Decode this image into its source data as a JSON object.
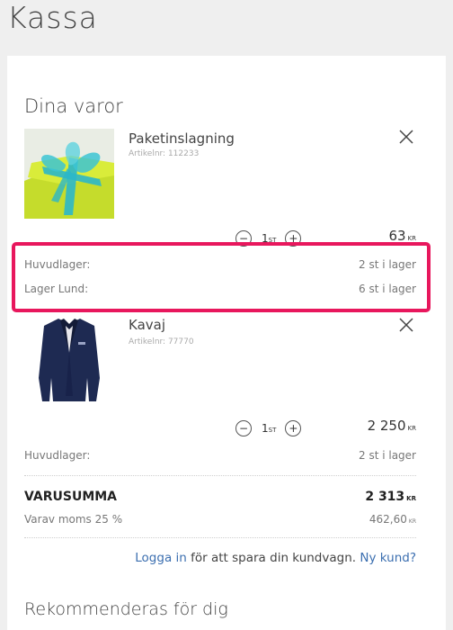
{
  "page": {
    "title": "Kassa"
  },
  "cart": {
    "heading": "Dina varor",
    "items": [
      {
        "name": "Paketinslagning",
        "article": "Artikelnr: 112233",
        "quantity": "1",
        "quantity_unit": "ST",
        "price": "63",
        "currency": "KR",
        "image_icon": "gift-box-image",
        "stock": [
          {
            "location": "Huvudlager:",
            "amount": "2 st i lager"
          },
          {
            "location": "Lager Lund:",
            "amount": "6 st i lager"
          }
        ]
      },
      {
        "name": "Kavaj",
        "article": "Artikelnr: 77770",
        "quantity": "1",
        "quantity_unit": "ST",
        "price": "2 250",
        "currency": "KR",
        "image_icon": "blazer-image",
        "stock": [
          {
            "location": "Huvudlager:",
            "amount": "2 st i lager"
          }
        ]
      }
    ],
    "decrement_symbol": "−",
    "increment_symbol": "+"
  },
  "summary": {
    "total_label": "VARUSUMMA",
    "total_value": "2 313",
    "total_currency": "KR",
    "vat_label": "Varav moms 25 %",
    "vat_value": "462,60",
    "vat_currency": "KR"
  },
  "login": {
    "login_link": "Logga in",
    "middle_text": "för att spara din kundvagn.",
    "new_customer_link": "Ny kund?"
  },
  "recommend": {
    "heading": "Rekommenderas för dig"
  },
  "colors": {
    "highlight": "#e8175d",
    "link": "#3c6fb0",
    "gift_box": "#d9ec3a",
    "ribbon": "#2bb7c9",
    "blazer": "#1e2a52"
  }
}
